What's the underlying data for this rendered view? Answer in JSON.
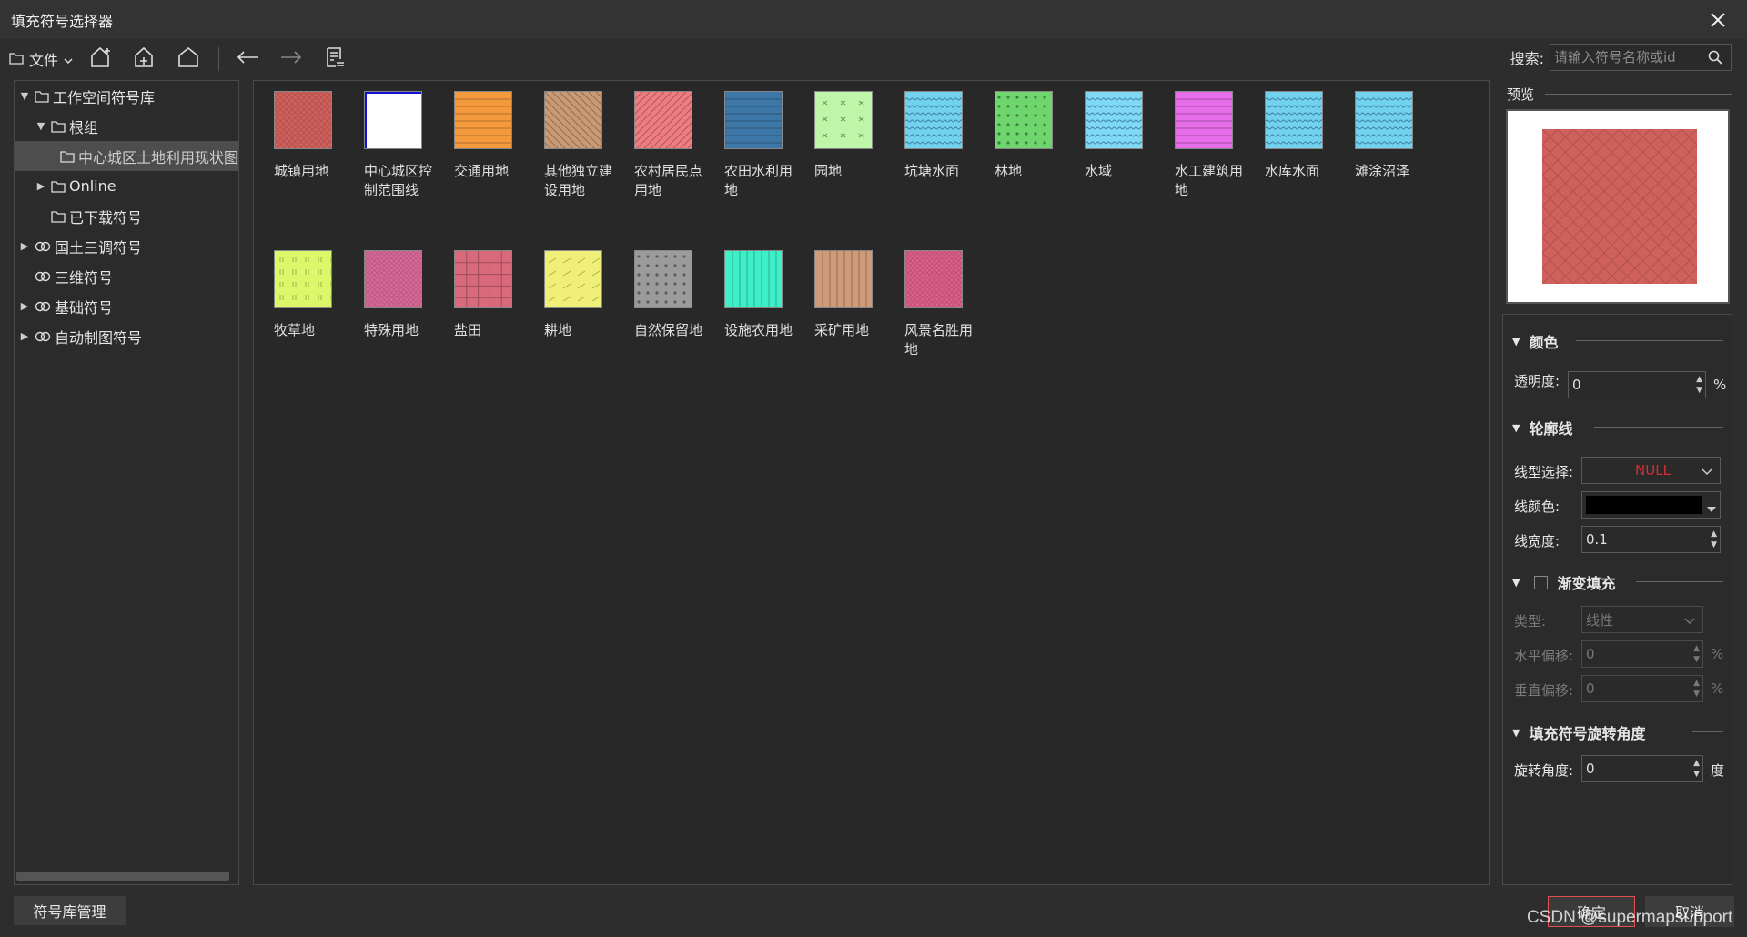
{
  "window": {
    "title": "填充符号选择器"
  },
  "toolbar": {
    "file_label": "文件"
  },
  "search": {
    "label": "搜索:",
    "placeholder": "请输入符号名称或id"
  },
  "tree": [
    {
      "label": "工作空间符号库",
      "level": 0,
      "expanded": true,
      "icon": "folder-icon"
    },
    {
      "label": "根组",
      "level": 1,
      "expanded": true,
      "icon": "folder-icon"
    },
    {
      "label": "中心城区土地利用现状图",
      "level": 2,
      "selected": true,
      "icon": "folder-icon"
    },
    {
      "label": "Online",
      "level": 1,
      "expanded": false,
      "icon": "folder-icon"
    },
    {
      "label": "已下载符号",
      "level": 1,
      "icon": "folder-icon"
    },
    {
      "label": "国土三调符号",
      "level": 0,
      "expanded": false,
      "icon": "link-icon"
    },
    {
      "label": "三维符号",
      "level": 0,
      "icon": "link-icon"
    },
    {
      "label": "基础符号",
      "level": 0,
      "expanded": false,
      "icon": "link-icon"
    },
    {
      "label": "自动制图符号",
      "level": 0,
      "expanded": false,
      "icon": "link-icon"
    }
  ],
  "symbols": [
    {
      "name": "城镇用地",
      "color": "#d0605c",
      "pattern": "cross"
    },
    {
      "name": "中心城区控制范围线",
      "color": "#ffffff",
      "pattern": "outline-blue"
    },
    {
      "name": "交通用地",
      "color": "#f59a3c",
      "pattern": "hlines"
    },
    {
      "name": "其他独立建设用地",
      "color": "#c99a74",
      "pattern": "diag-back"
    },
    {
      "name": "农村居民点用地",
      "color": "#ee7c80",
      "pattern": "diag"
    },
    {
      "name": "农田水利用地",
      "color": "#3d77a8",
      "pattern": "hlines"
    },
    {
      "name": "园地",
      "color": "#bff5a8",
      "pattern": "glyphs"
    },
    {
      "name": "坑塘水面",
      "color": "#72d2ee",
      "pattern": "waves"
    },
    {
      "name": "林地",
      "color": "#6fd66e",
      "pattern": "dots"
    },
    {
      "name": "水域",
      "color": "#7fd8f4",
      "pattern": "waves"
    },
    {
      "name": "水工建筑用地",
      "color": "#e66ee8",
      "pattern": "hlines"
    },
    {
      "name": "水库水面",
      "color": "#72d2ee",
      "pattern": "waves"
    },
    {
      "name": "滩涂沼泽",
      "color": "#72d2ee",
      "pattern": "waves"
    },
    {
      "name": "牧草地",
      "color": "#dcf76a",
      "pattern": "ticks"
    },
    {
      "name": "特殊用地",
      "color": "#d9699a",
      "pattern": "cross-fine"
    },
    {
      "name": "盐田",
      "color": "#d96a7c",
      "pattern": "grid"
    },
    {
      "name": "耕地",
      "color": "#f0f078",
      "pattern": "slashes"
    },
    {
      "name": "自然保留地",
      "color": "#9b9b9b",
      "pattern": "dots"
    },
    {
      "name": "设施农用地",
      "color": "#3ef0c8",
      "pattern": "vlines"
    },
    {
      "name": "采矿用地",
      "color": "#cf9a78",
      "pattern": "vlines"
    },
    {
      "name": "风景名胜用地",
      "color": "#dd5f8a",
      "pattern": "cross-fine"
    }
  ],
  "preview": {
    "label": "预览",
    "color": "#d0605c"
  },
  "props": {
    "color_section": "颜色",
    "opacity_label": "透明度:",
    "opacity_value": "0",
    "opacity_unit": "%",
    "outline_section": "轮廓线",
    "line_type_label": "线型选择:",
    "line_type_value": "NULL",
    "line_color_label": "线颜色:",
    "line_color": "#000000",
    "line_width_label": "线宽度:",
    "line_width_value": "0.1",
    "gradient_section": "渐变填充",
    "type_label": "类型:",
    "type_value": "线性",
    "hoffset_label": "水平偏移:",
    "hoffset_value": "0",
    "hoffset_unit": "%",
    "voffset_label": "垂直偏移:",
    "voffset_value": "0",
    "voffset_unit": "%",
    "rotation_section": "填充符号旋转角度",
    "rotation_label": "旋转角度:",
    "rotation_value": "0",
    "rotation_unit": "度"
  },
  "buttons": {
    "manage": "符号库管理",
    "ok": "确定",
    "cancel": "取消"
  },
  "watermark": "CSDN @supermapsupport"
}
